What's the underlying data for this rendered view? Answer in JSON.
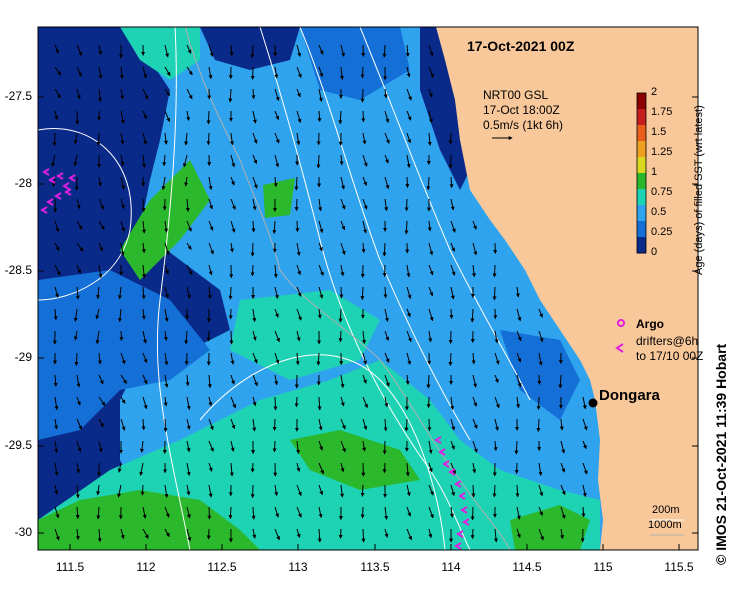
{
  "map": {
    "date_title": "17-Oct-2021 00Z",
    "current_label": {
      "line1": "NRT00 GSL",
      "line2": "17-Oct 18:00Z",
      "line3": "0.5m/s (1kt 6h)"
    },
    "town": "Dongara",
    "legend": {
      "argo": "Argo",
      "drifters_line1": "drifters@6h",
      "drifters_line2": "to 17/10 00Z"
    },
    "contours": {
      "line1": "200m",
      "line2": "1000m"
    },
    "colorbar": {
      "title": "Age (days) of filled SST (wrt latest)",
      "ticks": [
        "2",
        "1.75",
        "1.5",
        "1.25",
        "1",
        "0.75",
        "0.5",
        "0.25",
        "0"
      ],
      "colors": [
        "#8b0000",
        "#c41e1e",
        "#e8601c",
        "#f0a020",
        "#d8d820",
        "#2cb82c",
        "#1ed2b4",
        "#2fa3ee",
        "#1470d6",
        "#0a2a8a"
      ]
    },
    "credit": "© IMOS 21-Oct-2021 11:39 Hobart",
    "x_ticks": [
      "111.5",
      "112",
      "112.5",
      "113",
      "113.5",
      "114",
      "114.5",
      "115",
      "115.5"
    ],
    "y_ticks": [
      "-27.5",
      "-28",
      "-28.5",
      "-29",
      "-29.5",
      "-30"
    ],
    "colors": {
      "land": "#f9c89a",
      "deep_blue": "#0a2a8a",
      "mid_blue": "#1470d6",
      "light_blue": "#2fa3ee",
      "cyan": "#1ed2b4",
      "green": "#2cb82c",
      "yellow": "#e0e020",
      "argo_magenta": "#e020e0"
    }
  }
}
